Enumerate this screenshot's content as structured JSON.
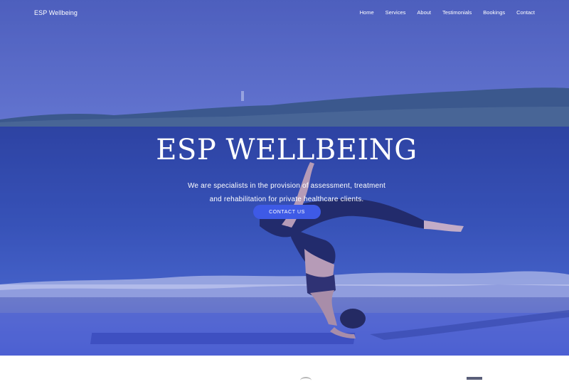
{
  "nav": {
    "brand": "ESP Wellbeing",
    "links": [
      "Home",
      "Services",
      "About",
      "Testimonials",
      "Bookings",
      "Contact"
    ]
  },
  "hero": {
    "title": "ESP WELLBEING",
    "subtitle_line1": "We are specialists in the provision of assessment, treatment",
    "subtitle_line2": "and rehabilitation for private healthcare clients.",
    "cta_label": "CONTACT US"
  },
  "colors": {
    "accent": "#3e5ae6",
    "overlay": "#3a54d2"
  }
}
